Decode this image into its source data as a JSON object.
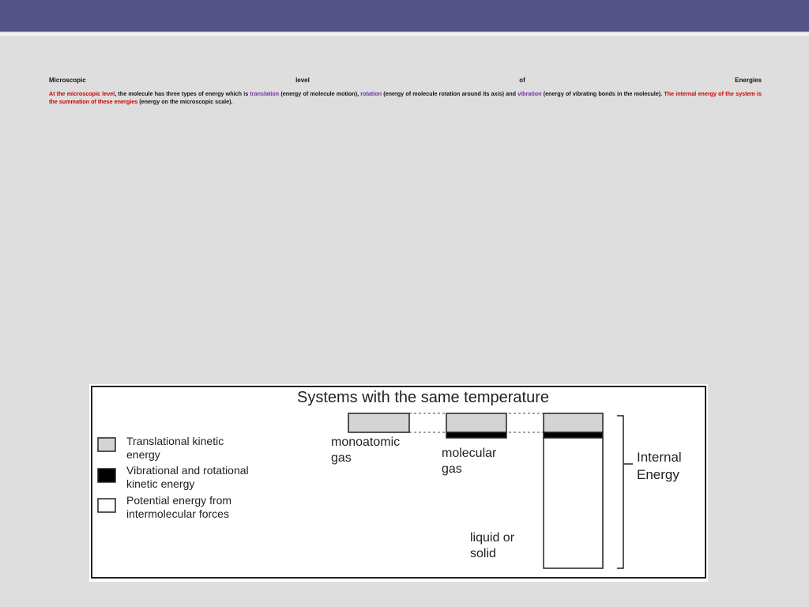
{
  "heading": {
    "word1": "Microscopic",
    "word2": "level",
    "word3": "of",
    "word4": "Energies"
  },
  "paragraph": {
    "p1": "At the microscopic level",
    "p2": ", the molecule has three types of energy which is ",
    "p3": "translation",
    "p4": " (energy of molecule motion), ",
    "p5": "rotation",
    "p6": " (energy of molecule rotation around its axis) and ",
    "p7": "vibration",
    "p8": " (energy of vibrating bonds in the molecule). ",
    "p9": "The internal energy of the system is the summation of these energies",
    "p10": " (energy on the microscopic scale)."
  },
  "figure": {
    "title": "Systems with the same temperature",
    "legend": [
      {
        "line1": "Translational kinetic",
        "line2": "energy",
        "fill": "#d4d4d4"
      },
      {
        "line1": "Vibrational and rotational",
        "line2": "kinetic energy",
        "fill": "#000000"
      },
      {
        "line1": "Potential energy from",
        "line2": "intermolecular forces",
        "fill": "#ffffff"
      }
    ],
    "monoatomic": {
      "line1": "monoatomic",
      "line2": "gas"
    },
    "molecular": {
      "line1": "molecular",
      "line2": "gas"
    },
    "liquid": {
      "line1": "liquid or",
      "line2": "solid"
    },
    "internal": {
      "line1": "Internal",
      "line2": "Energy"
    }
  },
  "colors": {
    "header_bar": "#535387",
    "highlight_red": "#cc0000",
    "highlight_purple": "#7030a0"
  }
}
